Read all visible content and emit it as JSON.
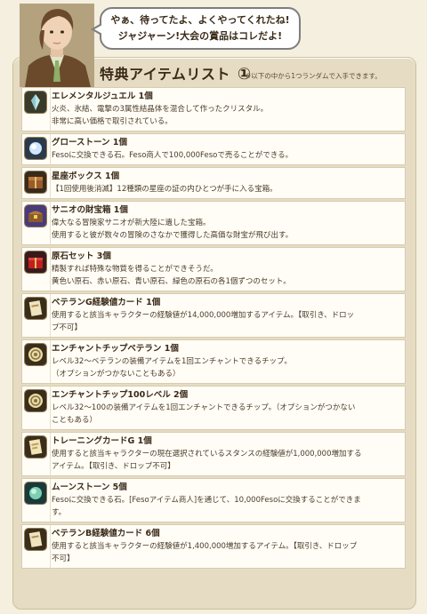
{
  "speech": [
    "やぁ、待ってたよ、よくやってくれたね!",
    "ジャジャーン!大会の賞品はコレだよ!"
  ],
  "title": "特典アイテムリスト",
  "title_number": "①",
  "note": "※以下の中から1つランダムで入手できます。",
  "items": [
    {
      "name": "エレメンタルジュエル 1個",
      "icon": "crystal-icon",
      "lines": [
        "火炎、氷結、電撃の3属性結晶体を混合して作ったクリスタル。",
        "非常に高い価格で取引されている。"
      ]
    },
    {
      "name": "グローストーン 1個",
      "icon": "glow-stone-icon",
      "lines": [
        "Fesoに交換できる石。Feso商人で100,000Fesoで売ることができる。"
      ]
    },
    {
      "name": "星座ボックス 1個",
      "icon": "star-box-icon",
      "lines": [
        "【1回使用後消滅】12種類の星座の証の内ひとつが手に入る宝箱。"
      ]
    },
    {
      "name": "サニオの財宝箱 1個",
      "icon": "treasure-chest-icon",
      "lines": [
        "偉大なる冒険家サニオが新大陸に遺した宝箱。",
        "使用すると彼が数々の冒険のさなかで獲得した高価な財宝が飛び出す。"
      ]
    },
    {
      "name": "原石セット 3個",
      "icon": "gem-set-icon",
      "lines": [
        "精製すれば特殊な物質を得ることができそうだ。",
        "黄色い原石、赤い原石、青い原石、緑色の原石の各1個ずつのセット。"
      ]
    },
    {
      "name": "ベテランG経験値カード 1個",
      "icon": "exp-card-icon",
      "lines": [
        "使用すると該当キャラクターの経験値が14,000,000増加するアイテム。【取引き、ドロッ",
        "プ不可】"
      ]
    },
    {
      "name": "エンチャントチップベテラン 1個",
      "icon": "enchant-chip-icon",
      "lines": [
        "レベル32～ベテランの装備アイテムを1回エンチャントできるチップ。",
        "（オプションがつかないこともある）"
      ]
    },
    {
      "name": "エンチャントチップ100レベル 2個",
      "icon": "enchant-chip-icon",
      "lines": [
        "レベル32～100の装備アイテムを1回エンチャントできるチップ。（オプションがつかない",
        "こともある）"
      ]
    },
    {
      "name": "トレーニングカードG 1個",
      "icon": "training-card-icon",
      "lines": [
        "使用すると該当キャラクターの現在選択されているスタンスの経験値が1,000,000増加する",
        "アイテム。【取引き、ドロップ不可】"
      ]
    },
    {
      "name": "ムーンストーン 5個",
      "icon": "moon-stone-icon",
      "lines": [
        "Fesoに交換できる石。[Fesoアイテム商人]を通じて、10,000Fesoに交換することができま",
        "す。"
      ]
    },
    {
      "name": "ベテランB経験値カード 6個",
      "icon": "exp-card-icon",
      "lines": [
        "使用すると該当キャラクターの経験値が1,400,000増加するアイテム。【取引き、ドロップ",
        "不可】"
      ]
    }
  ]
}
